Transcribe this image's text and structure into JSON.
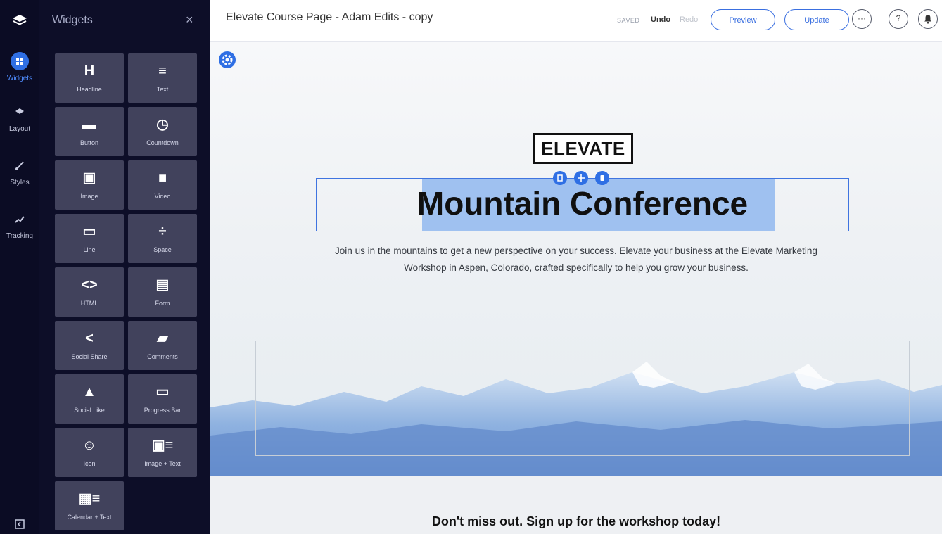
{
  "rail": {
    "items": [
      {
        "label": "Widgets",
        "icon": "grid-icon"
      },
      {
        "label": "Layout",
        "icon": "layers-icon"
      },
      {
        "label": "Styles",
        "icon": "brush-icon"
      },
      {
        "label": "Tracking",
        "icon": "trend-icon"
      }
    ]
  },
  "panel": {
    "title": "Widgets",
    "close": "×",
    "tiles": [
      {
        "label": "Headline",
        "glyph": "H",
        "icon": "headline-icon"
      },
      {
        "label": "Text",
        "glyph": "≡",
        "icon": "text-icon"
      },
      {
        "label": "Button",
        "glyph": "▬",
        "icon": "button-icon"
      },
      {
        "label": "Countdown",
        "glyph": "◷",
        "icon": "clock-icon"
      },
      {
        "label": "Image",
        "glyph": "▣",
        "icon": "image-icon"
      },
      {
        "label": "Video",
        "glyph": "■",
        "icon": "video-icon"
      },
      {
        "label": "Line",
        "glyph": "▭",
        "icon": "line-icon"
      },
      {
        "label": "Space",
        "glyph": "÷",
        "icon": "space-icon"
      },
      {
        "label": "HTML",
        "glyph": "<>",
        "icon": "code-icon"
      },
      {
        "label": "Form",
        "glyph": "▤",
        "icon": "form-icon"
      },
      {
        "label": "Social Share",
        "glyph": "<",
        "icon": "share-icon"
      },
      {
        "label": "Comments",
        "glyph": "▰",
        "icon": "comments-icon"
      },
      {
        "label": "Social Like",
        "glyph": "▲",
        "icon": "thumbs-up-icon"
      },
      {
        "label": "Progress Bar",
        "glyph": "▭",
        "icon": "progress-bar-icon"
      },
      {
        "label": "Icon",
        "glyph": "☺",
        "icon": "smiley-icon"
      },
      {
        "label": "Image + Text",
        "glyph": "▣≡",
        "icon": "image-text-icon"
      },
      {
        "label": "Calendar + Text",
        "glyph": "▦≡",
        "icon": "calendar-text-icon"
      }
    ]
  },
  "topbar": {
    "title": "Elevate Course Page - Adam Edits - copy",
    "saved": "SAVED",
    "undo": "Undo",
    "redo": "Redo",
    "preview": "Preview",
    "update": "Update",
    "more": "···",
    "help": "?"
  },
  "canvas": {
    "brand": "ELEVATE",
    "headline": "Mountain Conference",
    "subtitle": "Join us in the mountains to get a new perspective on your success. Elevate your business at the Elevate Marketing Workshop in Aspen, Colorado, crafted specifically to help you grow your business.",
    "cta": "Don't miss out. Sign up for the workshop today!"
  },
  "colors": {
    "accent": "#2f6fe4",
    "rail_bg": "#0b0c24",
    "panel_bg": "#0d0e28",
    "tile_bg": "#41425c",
    "highlight": "#9fc1f0"
  }
}
